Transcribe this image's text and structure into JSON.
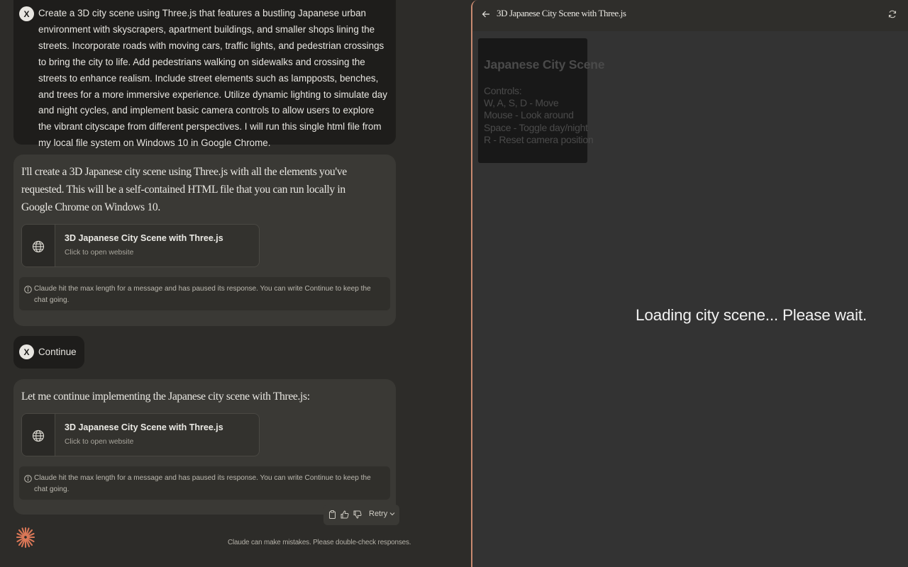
{
  "chat": {
    "user_avatar_letter": "X",
    "messages": [
      {
        "role": "user",
        "text": "Create a 3D city scene using Three.js that features a bustling Japanese urban environment with skyscrapers, apartment buildings, and smaller shops lining the streets. Incorporate roads with moving cars, traffic lights, and pedestrian crossings to bring the city to life. Add pedestrians walking on sidewalks and crossing the streets to enhance realism. Include street elements such as lampposts, benches, and trees for a more immersive experience. Utilize dynamic lighting to simulate day and night cycles, and implement basic camera controls to allow users to explore the vibrant cityscape from different perspectives. I will run this single html file from my local file system on Windows 10 in Google Chrome."
      },
      {
        "role": "assistant",
        "text": "I'll create a 3D Japanese city scene using Three.js with all the elements you've requested. This will be a self-contained HTML file that you can run locally in Google Chrome on Windows 10.",
        "artifact": {
          "title": "3D Japanese City Scene with Three.js",
          "subtitle": "Click to open website",
          "icon": "globe-icon"
        },
        "notice": "Claude hit the max length for a message and has paused its response. You can write Continue to keep the chat going."
      },
      {
        "role": "user",
        "text": "Continue"
      },
      {
        "role": "assistant",
        "text": "Let me continue implementing the Japanese city scene with Three.js:",
        "artifact": {
          "title": "3D Japanese City Scene with Three.js",
          "subtitle": "Click to open website",
          "icon": "globe-icon"
        },
        "notice": "Claude hit the max length for a message and has paused its response. You can write Continue to keep the chat going."
      }
    ],
    "actions": {
      "copy_icon": "copy-icon",
      "thumbs_up_icon": "thumbs-up-icon",
      "thumbs_down_icon": "thumbs-down-icon",
      "retry_label": "Retry"
    },
    "disclaimer": "Claude can make mistakes. Please double-check responses."
  },
  "artifact_pane": {
    "title": "3D Japanese City Scene with Three.js",
    "preview": {
      "controls_title": "Japanese City Scene",
      "controls_lines": [
        "Controls:",
        "W, A, S, D - Move",
        "Mouse - Look around",
        "Space - Toggle day/night",
        "R - Reset camera position"
      ],
      "loading_text": "Loading city scene... Please wait."
    }
  },
  "colors": {
    "accent": "#d97757",
    "pane_border": "#c88a70",
    "background": "#2d2c29",
    "assistant_bubble": "#3a3935",
    "user_bubble": "#1e1d1b"
  }
}
